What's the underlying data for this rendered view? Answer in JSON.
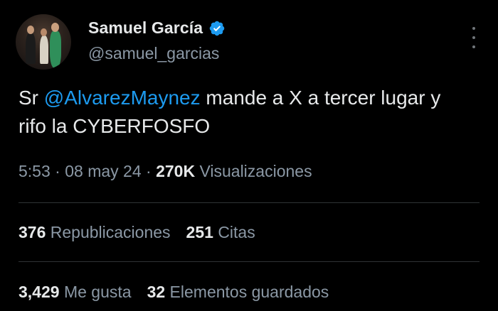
{
  "author": {
    "name": "Samuel García",
    "handle": "@samuel_garcias"
  },
  "tweet": {
    "text_before": "Sr ",
    "mention": "@AlvarezMaynez",
    "text_after": " mande a X a tercer lugar y rifo la CYBERFOSFO"
  },
  "meta": {
    "time": "5:53",
    "date": "08 may 24",
    "separator": " · ",
    "views_count": "270K",
    "views_label": "Visualizaciones"
  },
  "stats": {
    "reposts_count": "376",
    "reposts_label": "Republicaciones",
    "quotes_count": "251",
    "quotes_label": "Citas",
    "likes_count": "3,429",
    "likes_label": "Me gusta",
    "bookmarks_count": "32",
    "bookmarks_label": "Elementos guardados"
  },
  "icons": {
    "verified": "verified-badge-icon",
    "more": "more-options-icon"
  },
  "colors": {
    "background": "#000000",
    "text": "#e7e9ea",
    "secondary": "#8b98a5",
    "accent": "#1d9bf0",
    "divider": "#2f3336"
  }
}
